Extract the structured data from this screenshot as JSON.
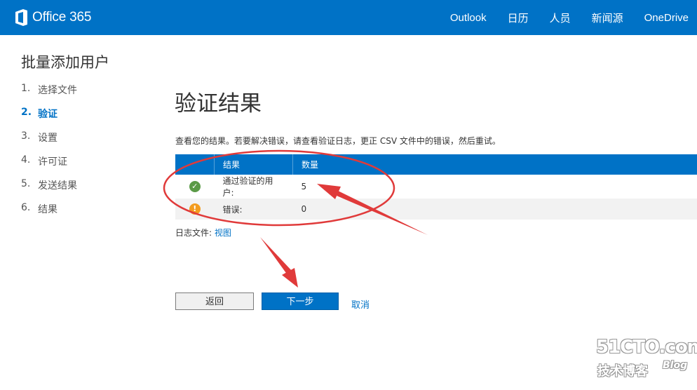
{
  "header": {
    "logo_text": "Office 365",
    "nav": [
      "Outlook",
      "日历",
      "人员",
      "新闻源",
      "OneDrive"
    ]
  },
  "sidebar": {
    "title": "批量添加用户",
    "steps": [
      {
        "num": "1.",
        "label": "选择文件"
      },
      {
        "num": "2.",
        "label": "验证"
      },
      {
        "num": "3.",
        "label": "设置"
      },
      {
        "num": "4.",
        "label": "许可证"
      },
      {
        "num": "5.",
        "label": "发送结果"
      },
      {
        "num": "6.",
        "label": "结果"
      }
    ],
    "active_step": 2
  },
  "main": {
    "title": "验证结果",
    "description": "查看您的结果。若要解决错误，请查看验证日志，更正 CSV 文件中的错误，然后重试。",
    "table": {
      "headers": [
        "结果",
        "数量"
      ],
      "rows": [
        {
          "icon": "check-circle-icon",
          "result": "通过验证的用户:",
          "count": "5"
        },
        {
          "icon": "warning-circle-icon",
          "result": "错误:",
          "count": "0"
        }
      ]
    },
    "logfile_label": "日志文件:",
    "logfile_link": "视图"
  },
  "buttons": {
    "back": "返回",
    "next": "下一步",
    "cancel": "取消"
  },
  "watermark": {
    "site": "51CTO.com",
    "sub": "技术博客",
    "blog": "Blog"
  },
  "colors": {
    "brand_blue": "#0072c6",
    "annotation_red": "#e03a3a",
    "ok_green": "#5b9a47",
    "warn_orange": "#f39c1e"
  }
}
